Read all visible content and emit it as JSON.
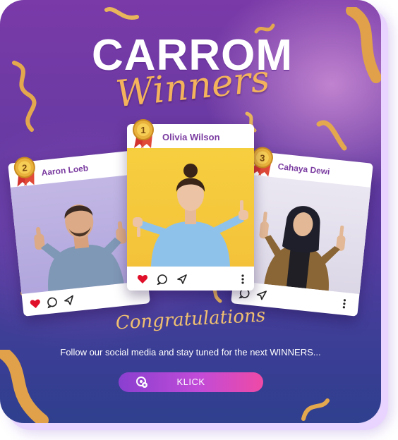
{
  "header": {
    "title_main": "CARROM",
    "title_script": "Winners"
  },
  "posts": [
    {
      "rank": "1",
      "name": "Olivia Wilson"
    },
    {
      "rank": "2",
      "name": "Aaron Loeb"
    },
    {
      "rank": "3",
      "name": "Cahaya Dewi"
    }
  ],
  "footer": {
    "congrats": "Congratulations",
    "message": "Follow our social media and stay tuned for the next WINNERS...",
    "button_label": "KLICK"
  },
  "colors": {
    "background_top": "#7a3aa8",
    "background_bottom": "#2f3f8e",
    "accent_gold": "#f3b35c",
    "name_purple": "#7a3ba0",
    "heart_red": "#e0102a",
    "button_start": "#8a3fcf",
    "button_end": "#ef4aa6"
  },
  "icons": [
    "medal-icon",
    "heart-icon",
    "comment-icon",
    "send-icon",
    "more-icon",
    "button-icon",
    "confetti-ribbon"
  ]
}
